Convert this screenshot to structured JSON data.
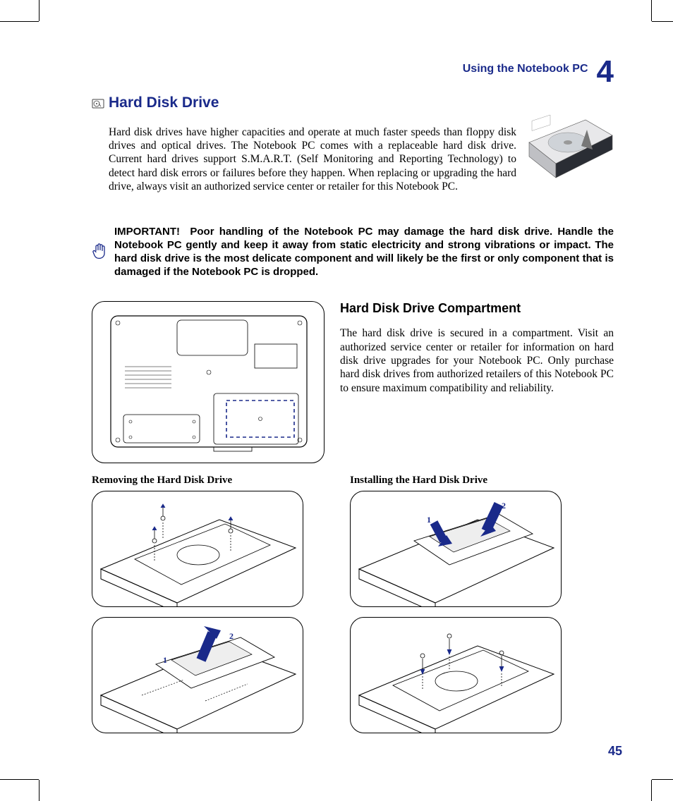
{
  "chapter": {
    "title": "Using the Notebook PC",
    "number": "4"
  },
  "hdd": {
    "heading": "Hard Disk Drive",
    "body": "Hard disk drives have higher capacities and operate at much faster speeds than floppy disk drives and optical drives. The Notebook PC comes with a replaceable hard disk drive. Current hard drives support S.M.A.R.T. (Self Monitoring and Reporting Technology) to detect hard disk errors or failures before they happen. When replacing or upgrading the hard drive, always visit an authorized service center or retailer for this Notebook PC."
  },
  "important": {
    "label": "IMPORTANT!",
    "text": "Poor handling of the Notebook PC may damage the hard disk drive. Handle the Notebook PC gently and keep it away from static electricity and strong vibrations or impact. The hard disk drive is the most delicate component and will likely be the first or only component that is damaged if the Notebook PC is dropped."
  },
  "compartment": {
    "heading": "Hard Disk Drive Compartment",
    "body": "The hard disk drive is secured in a compartment. Visit an authorized service center or retailer for information on hard disk drive upgrades for your Notebook PC. Only purchase hard disk drives from authorized retailers of this Notebook PC to ensure maximum compatibility and reliability."
  },
  "procedures": {
    "removing": "Removing the Hard Disk Drive",
    "installing": "Installing the Hard Disk Drive"
  },
  "page_number": "45"
}
